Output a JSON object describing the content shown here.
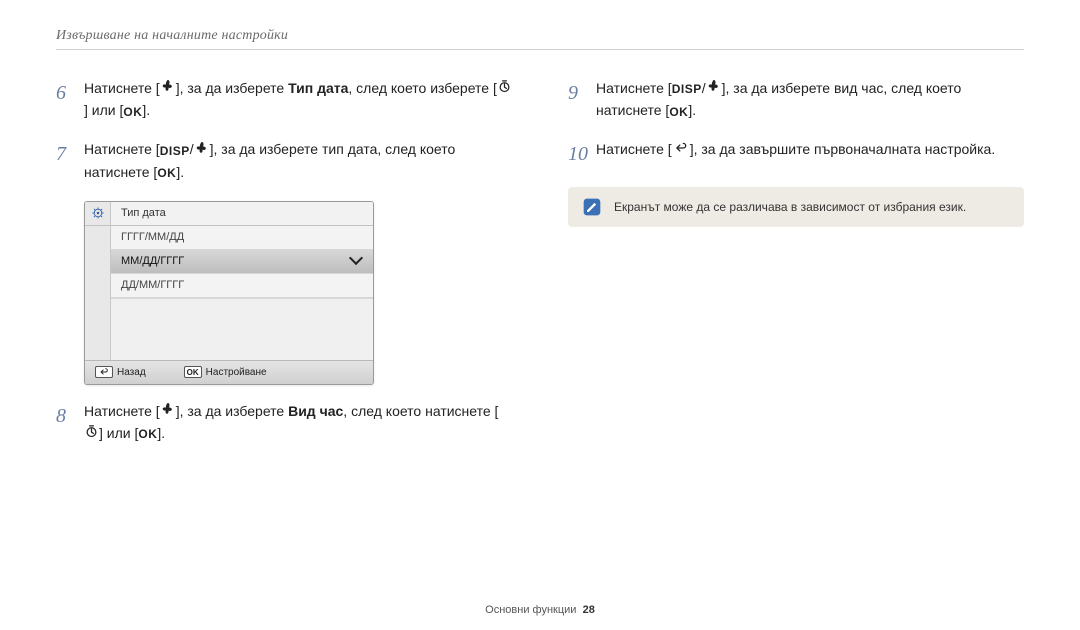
{
  "header": {
    "title": "Извършване на началните настройки"
  },
  "left": {
    "step6": {
      "num": "6",
      "t1": "Натиснете [",
      "t2": "], за да изберете ",
      "bold": "Тип дата",
      "t3": ", след което изберете [",
      "t4": "] или [",
      "t5": "]."
    },
    "step7": {
      "num": "7",
      "t1": "Натиснете [",
      "t2": "], за да изберете тип дата, след което натиснете [",
      "t3": "]."
    },
    "menu": {
      "title": "Тип дата",
      "opt1": "ГГГГ/ММ/ДД",
      "opt2": "ММ/ДД/ГГГГ",
      "opt3": "ДД/ММ/ГГГГ",
      "back_label": "Назад",
      "set_label": "Настройване",
      "ok_key": "OK"
    },
    "step8": {
      "num": "8",
      "t1": "Натиснете [",
      "t2": "], за да изберете ",
      "bold": "Вид час",
      "t3": ", след което натиснете [",
      "t4": "] или [",
      "t5": "]."
    }
  },
  "right": {
    "step9": {
      "num": "9",
      "t1": "Натиснете [",
      "t2": "], за да изберете вид час, след което натиснете [",
      "t3": "]."
    },
    "step10": {
      "num": "10",
      "t1": "Натиснете [",
      "t2": "], за да завършите първоначалната настройка."
    },
    "note": {
      "text": "Екранът може да се различава в зависимост от избрания език."
    }
  },
  "labels": {
    "ok": "OK",
    "disp": "DISP",
    "slash": "/"
  },
  "footer": {
    "section": "Основни функции",
    "page": "28"
  }
}
